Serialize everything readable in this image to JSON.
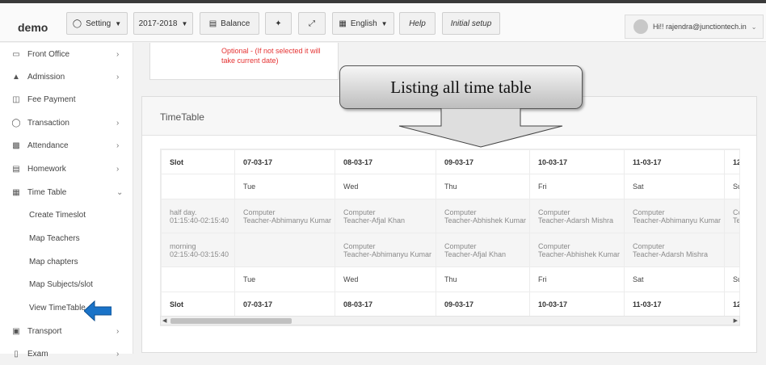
{
  "navbar": {
    "brand": "demo",
    "setting_label": "Setting",
    "year_label": "2017-2018",
    "balance_label": "Balance",
    "language_label": "English",
    "help_label": "Help",
    "initial_setup_label": "Initial setup",
    "user_label": "Hi!! rajendra@junctiontech.in"
  },
  "sidebar": {
    "items": [
      {
        "label": "Front Office",
        "icon": "monitor-icon"
      },
      {
        "label": "Admission",
        "icon": "graduation-cap-icon"
      },
      {
        "label": "Fee Payment",
        "icon": "money-icon"
      },
      {
        "label": "Transaction",
        "icon": "globe-icon"
      },
      {
        "label": "Attendance",
        "icon": "bar-chart-icon"
      },
      {
        "label": "Homework",
        "icon": "book-icon"
      },
      {
        "label": "Time Table",
        "icon": "calendar-icon"
      },
      {
        "label": "Transport",
        "icon": "bus-icon"
      },
      {
        "label": "Exam",
        "icon": "document-icon"
      }
    ],
    "sub_items": [
      "Create Timeslot",
      "Map Teachers",
      "Map chapters",
      "Map Subjects/slot",
      "View TimeTable"
    ]
  },
  "form": {
    "optional_note": "Optional - (If not selected it will take current date)"
  },
  "callout": {
    "text": "Listing all  time table"
  },
  "timetable": {
    "title": "TimeTable",
    "slot_header": "Slot",
    "dates": [
      "07-03-17",
      "08-03-17",
      "09-03-17",
      "10-03-17",
      "11-03-17",
      "12"
    ],
    "days": [
      "Tue",
      "Wed",
      "Thu",
      "Fri",
      "Sat",
      "Su"
    ],
    "rows": [
      {
        "slot_name": "half day.",
        "slot_time": "01:15:40-02:15:40",
        "cells": [
          {
            "subject": "Computer",
            "teacher": "Teacher-Abhimanyu Kumar"
          },
          {
            "subject": "Computer",
            "teacher": "Teacher-Afjal Khan"
          },
          {
            "subject": "Computer",
            "teacher": "Teacher-Abhishek Kumar"
          },
          {
            "subject": "Computer",
            "teacher": "Teacher-Adarsh Mishra"
          },
          {
            "subject": "Computer",
            "teacher": "Teacher-Abhimanyu Kumar"
          },
          {
            "subject": "Co",
            "teacher": "Tec"
          }
        ]
      },
      {
        "slot_name": "morning",
        "slot_time": "02:15:40-03:15:40",
        "cells": [
          {
            "subject": "",
            "teacher": ""
          },
          {
            "subject": "Computer",
            "teacher": "Teacher-Abhimanyu Kumar"
          },
          {
            "subject": "Computer",
            "teacher": "Teacher-Afjal Khan"
          },
          {
            "subject": "Computer",
            "teacher": "Teacher-Abhishek Kumar"
          },
          {
            "subject": "Computer",
            "teacher": "Teacher-Adarsh Mishra"
          },
          {
            "subject": "",
            "teacher": ""
          }
        ]
      }
    ]
  },
  "colors": {
    "accent_blue": "#1a73c8",
    "optional_red": "#e53333"
  }
}
